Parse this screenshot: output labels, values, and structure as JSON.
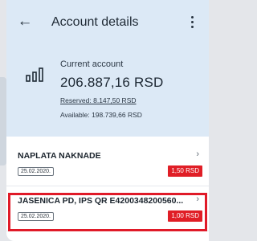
{
  "header": {
    "title": "Account details",
    "back_icon": "arrow-left-icon",
    "menu_icon": "more-vertical-icon"
  },
  "account": {
    "icon": "bar-chart-icon",
    "label": "Current account",
    "balance": "206.887,16 RSD",
    "reserved": "Reserved: 8.147,50 RSD",
    "available": "Available: 198.739,66 RSD"
  },
  "transactions": [
    {
      "name": "NAPLATA NAKNADE",
      "date": "25.02.2020.",
      "amount": "1,50 RSD",
      "amount_color": "#e01e26"
    },
    {
      "name": "JASENICA PD, IPS QR E4200348200560...",
      "date": "25.02.2020.",
      "amount": "1,00 RSD",
      "amount_color": "#e01e26",
      "highlighted": true
    }
  ],
  "colors": {
    "header_bg": "#dce9f6",
    "accent_red": "#e01e26",
    "highlight_border": "#e01a28"
  }
}
